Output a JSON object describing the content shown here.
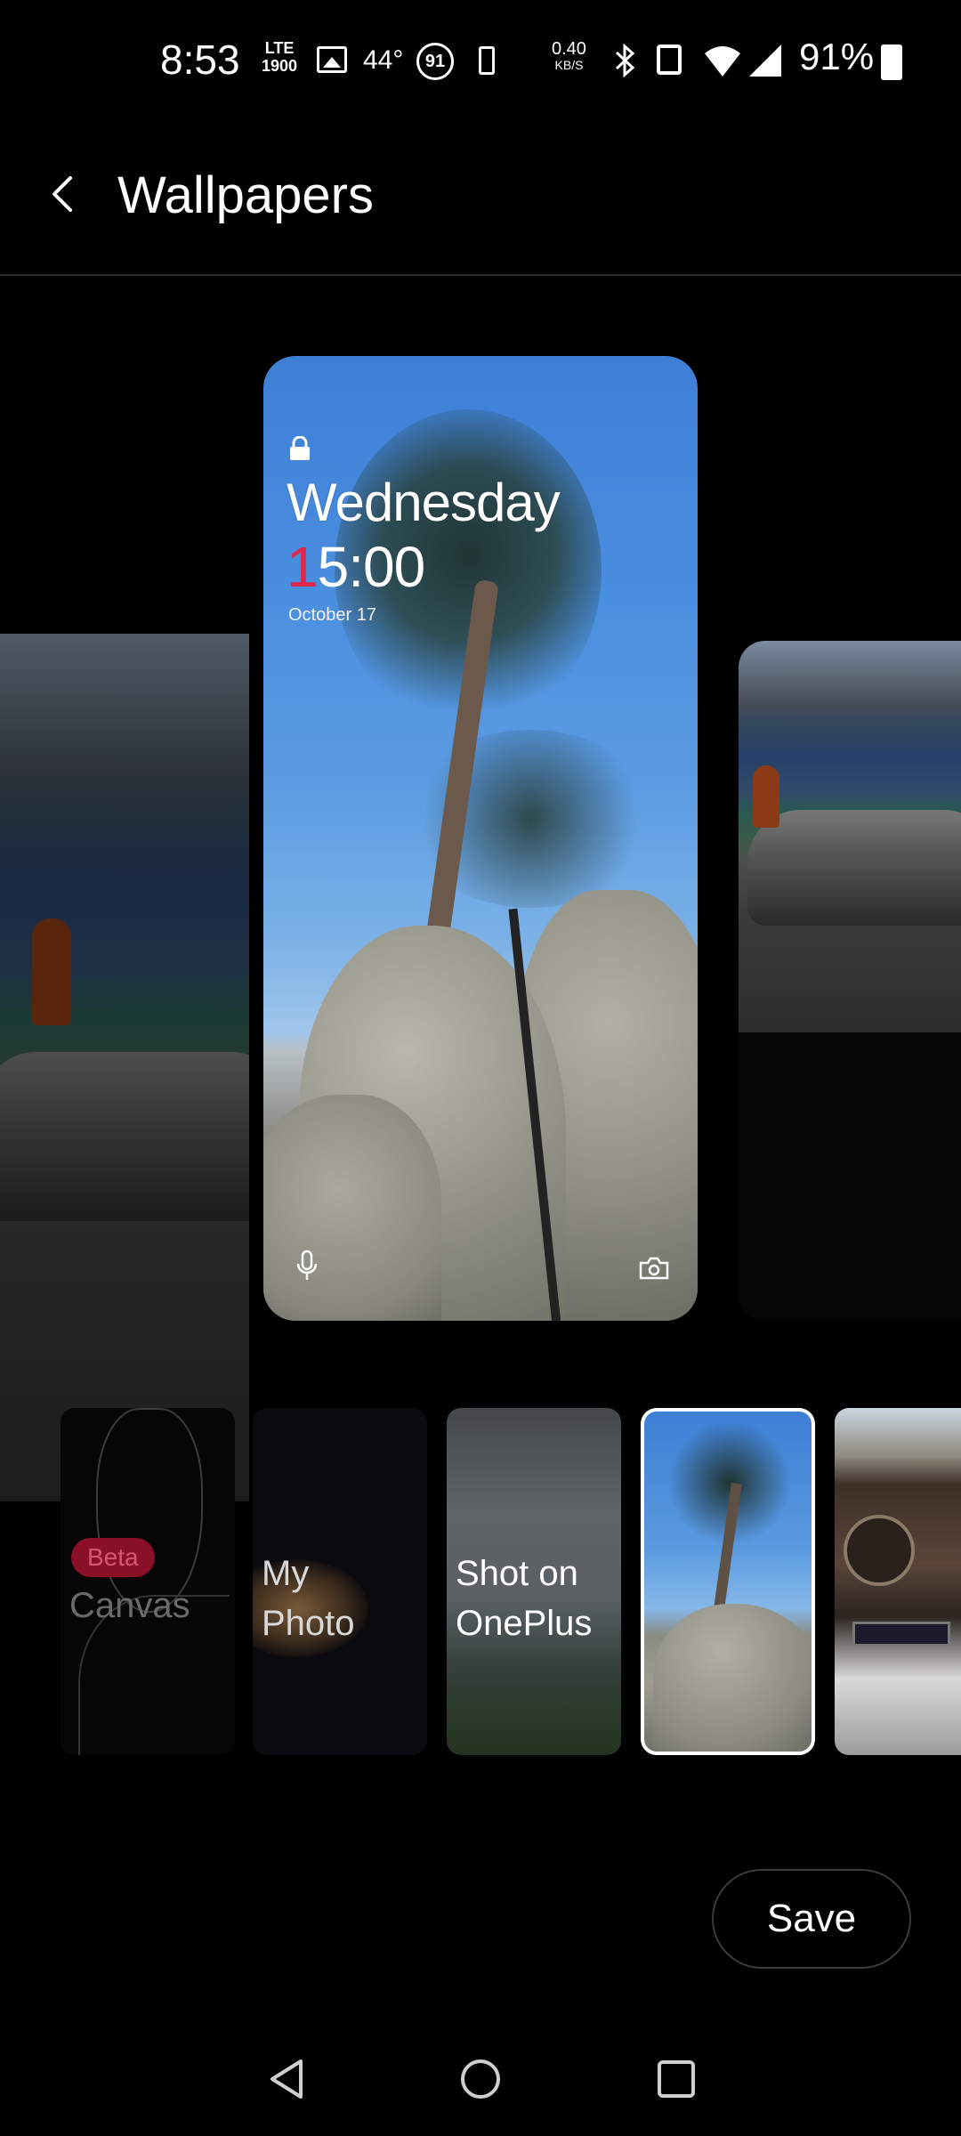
{
  "status_bar": {
    "time": "8:53",
    "network": "LTE",
    "network_band": "1900",
    "temperature": "44°",
    "badge": "91",
    "speed_value": "0.40",
    "speed_unit": "KB/S",
    "battery_percent": "91%",
    "icons": [
      "lte-icon",
      "image-icon",
      "badge-icon",
      "battery-saver-icon",
      "bluetooth-icon",
      "vibrate-icon",
      "wifi-icon",
      "signal-icon",
      "battery-icon"
    ]
  },
  "header": {
    "title": "Wallpapers",
    "back_icon": "chevron-left-icon"
  },
  "preview": {
    "day": "Wednesday",
    "time_first_digit": "1",
    "time_rest": "5:00",
    "date": "October 17",
    "lock_icon": "lock-icon",
    "left_shortcut_icon": "mic-icon",
    "right_shortcut_icon": "camera-icon",
    "accent_color": "#e0264a"
  },
  "categories": [
    {
      "label_line1": "Canvas",
      "label_line2": "",
      "badge": "Beta"
    },
    {
      "label_line1": "My",
      "label_line2": "Photo"
    },
    {
      "label_line1": "Shot on",
      "label_line2": "OnePlus"
    }
  ],
  "actions": {
    "save_label": "Save"
  },
  "nav": {
    "back_icon": "nav-back-icon",
    "home_icon": "nav-home-icon",
    "recents_icon": "nav-recents-icon"
  }
}
